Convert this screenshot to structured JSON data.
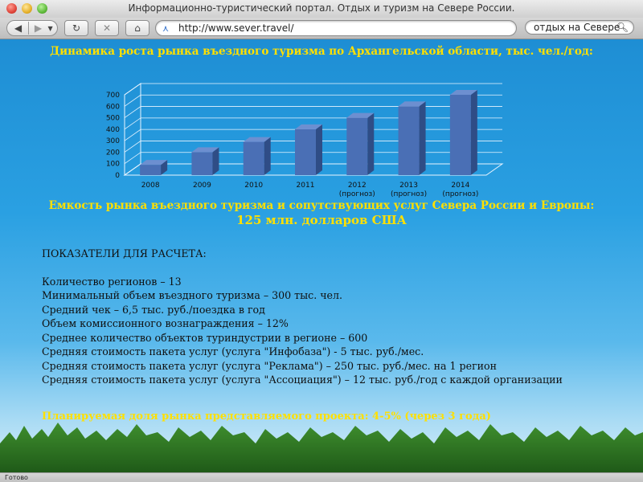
{
  "window": {
    "title": "Информационно-туристический портал. Отдых и туризм на Севере России."
  },
  "toolbar": {
    "back_icon": "◀",
    "forward_icon": "▶",
    "reload_icon": "↻",
    "stop_icon": "✕",
    "home_icon": "⌂",
    "url": "http://www.sever.travel/",
    "search_value": "отдых на Севере"
  },
  "page": {
    "heading1": "Динамика роста рынка въездного туризма по Архангельской области, тыс. чел./год:",
    "heading2": "Емкость рынка въездного туризма и сопутствующих услуг Севера России и Европы:",
    "heading3": "125 млн. долларов США",
    "section_title": "ПОКАЗАТЕЛИ ДЛЯ РАСЧЕТА:",
    "indicators": [
      "Количество регионов – 13",
      "Минимальный объем въездного туризма – 300 тыс. чел.",
      "Средний чек –  6,5 тыс.  руб./поездка в год",
      "Объем комиссионного вознаграждения – 12%",
      "Среднее количество объектов туриндустрии в регионе –  600",
      "Средняя стоимость пакета услуг (услуга \"Инфобаза\") -  5 тыс. руб./мес.",
      "Средняя стоимость пакета услуг (услуга \"Реклама\") – 250 тыс.  руб./мес. на 1 регион",
      "Средняя стоимость пакета услуг (услуга \"Ассоциация\") – 12 тыс. руб./год  с каждой организации"
    ],
    "planned": "Планируемая доля рынка представляемого проекта:  4-5% (через  3 года)"
  },
  "status": {
    "text": "Готово"
  },
  "colors": {
    "heading": "#ffe000",
    "bar_front": "#4a6fb5",
    "bar_side": "#2f4d86",
    "bar_top": "#6d8fd0",
    "background_top": "#1e8ed4"
  },
  "chart_data": {
    "type": "bar",
    "categories": [
      "2008",
      "2009",
      "2010",
      "2011",
      "2012",
      "2013",
      "2014"
    ],
    "category_notes": [
      "",
      "",
      "",
      "",
      "(прогноз)",
      "(прогноз)",
      "(прогноз)"
    ],
    "values": [
      90,
      200,
      290,
      400,
      500,
      600,
      700
    ],
    "ylim": [
      0,
      700
    ],
    "yticks": [
      0,
      100,
      200,
      300,
      400,
      500,
      600,
      700
    ],
    "title": "",
    "xlabel": "",
    "ylabel": "",
    "grid": true,
    "style": "3d"
  }
}
